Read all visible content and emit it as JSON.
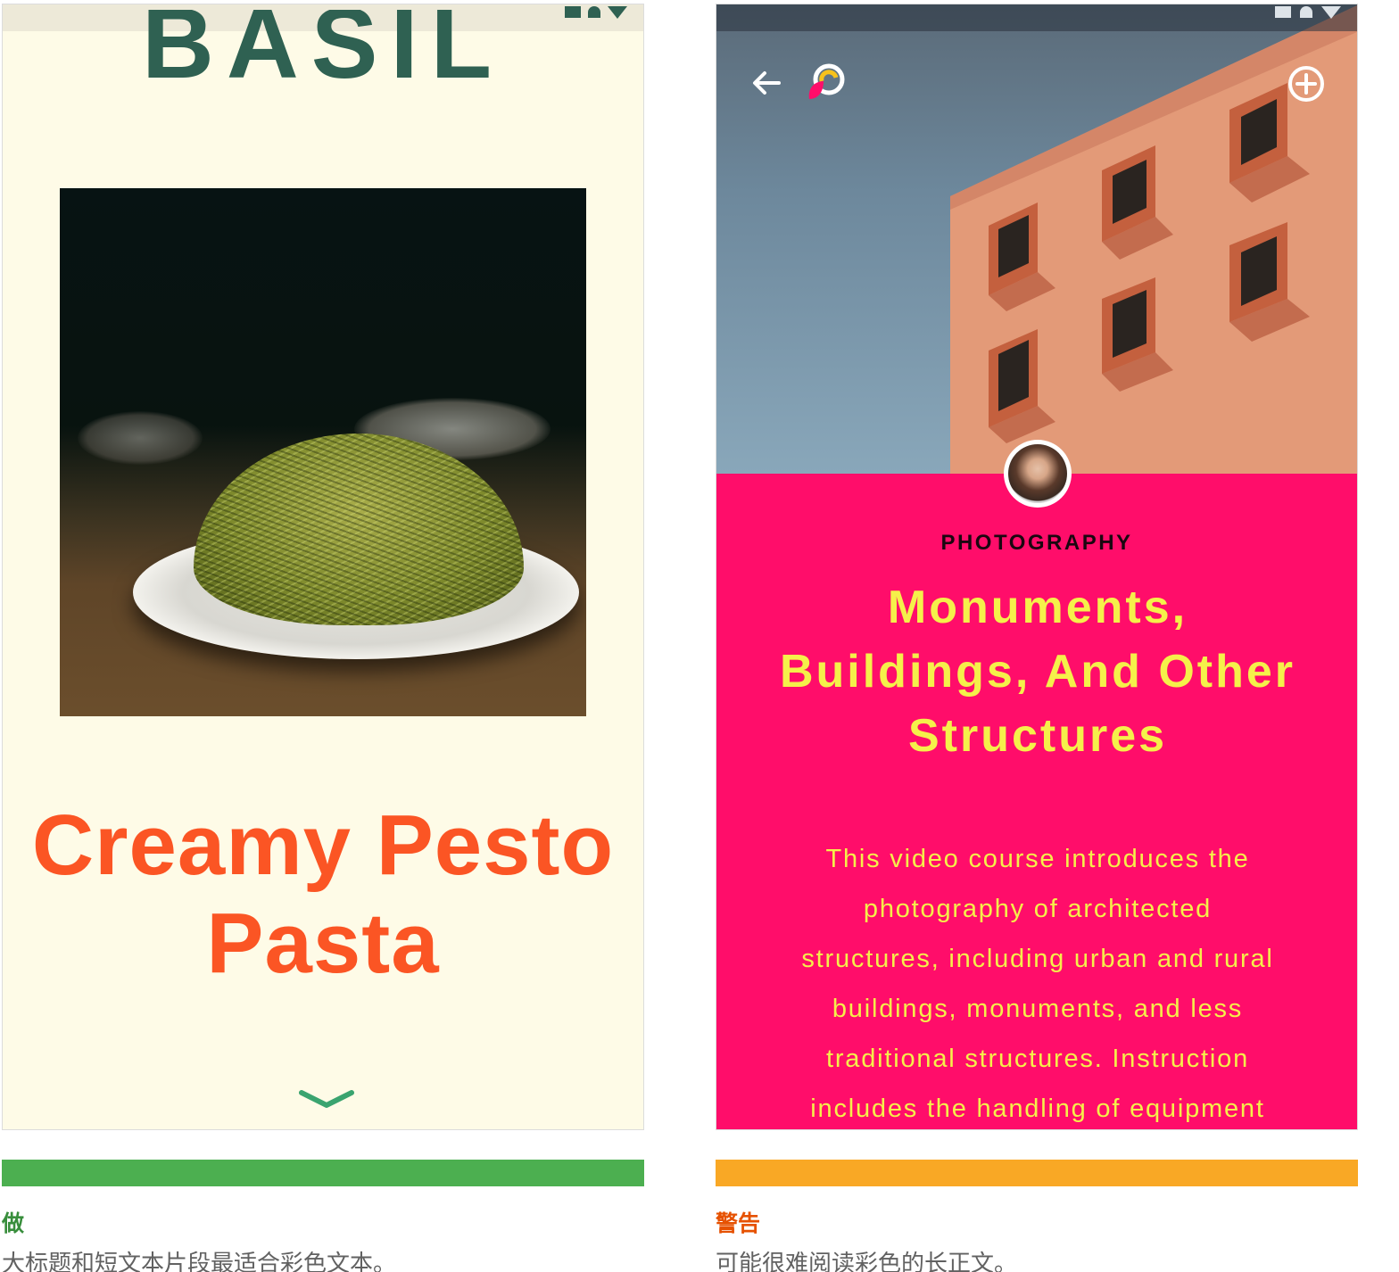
{
  "left_example": {
    "brand": "BASIL",
    "recipe_title_line1": "Creamy Pesto",
    "recipe_title_line2": "Pasta",
    "colors": {
      "background": "#fefbe7",
      "brand": "#2f6152",
      "title": "#fb5524"
    },
    "icons": [
      "signal-icon",
      "wifi-icon",
      "battery-icon",
      "chevron-down-icon"
    ]
  },
  "right_example": {
    "category": "PHOTOGRAPHY",
    "title_line1": "Monuments,",
    "title_line2": "Buildings, And Other",
    "title_line3": "Structures",
    "body_lines": [
      "This video course introduces the",
      "photography of architected",
      "structures, including urban and rural",
      "buildings, monuments, and less",
      "traditional structures. Instruction",
      "includes the handling of equipment"
    ],
    "colors": {
      "background": "#ff0d6a",
      "text": "#f5f04a",
      "category": "#1a0710"
    },
    "icons": [
      "back-arrow-icon",
      "app-logo-icon",
      "add-circle-icon",
      "avatar"
    ]
  },
  "captions": {
    "do_label": "做",
    "do_text": "大标题和短文本片段最适合彩色文本。",
    "do_color": "#4caf50",
    "caution_label": "警告",
    "caution_text": "可能很难阅读彩色的长正文。",
    "caution_color": "#f9a825"
  }
}
